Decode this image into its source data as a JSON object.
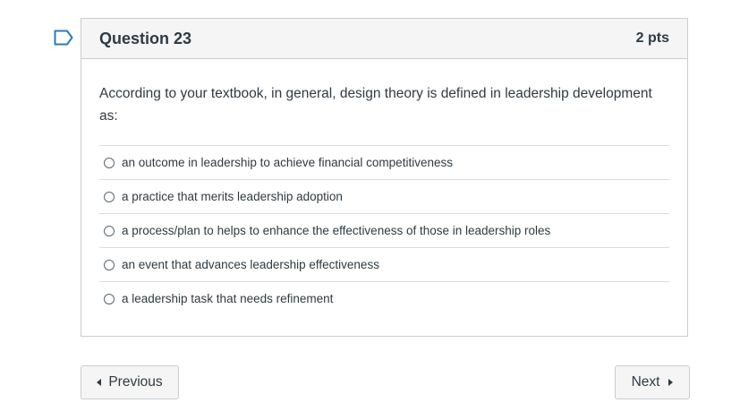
{
  "question": {
    "title": "Question 23",
    "points": "2 pts",
    "text": "According to your textbook, in general, design theory is defined in leadership development as:",
    "answers": [
      {
        "label": "an outcome in leadership to achieve financial competitiveness",
        "selected": false
      },
      {
        "label": "a practice that merits leadership adoption",
        "selected": false
      },
      {
        "label": "a process/plan to helps to enhance the effectiveness of those in leadership roles",
        "selected": false
      },
      {
        "label": "an event that advances leadership effectiveness",
        "selected": false
      },
      {
        "label": "a leadership task that needs refinement",
        "selected": false
      }
    ]
  },
  "nav": {
    "previous_label": "Previous",
    "next_label": "Next"
  },
  "colors": {
    "flag_border": "#2b7abc",
    "text": "#2d3b45",
    "header_bg": "#f5f5f5",
    "border": "#c7cdd1"
  },
  "icons": {
    "flag": "bookmark-flag-icon",
    "previous": "triangle-left-icon",
    "next": "triangle-right-icon"
  }
}
